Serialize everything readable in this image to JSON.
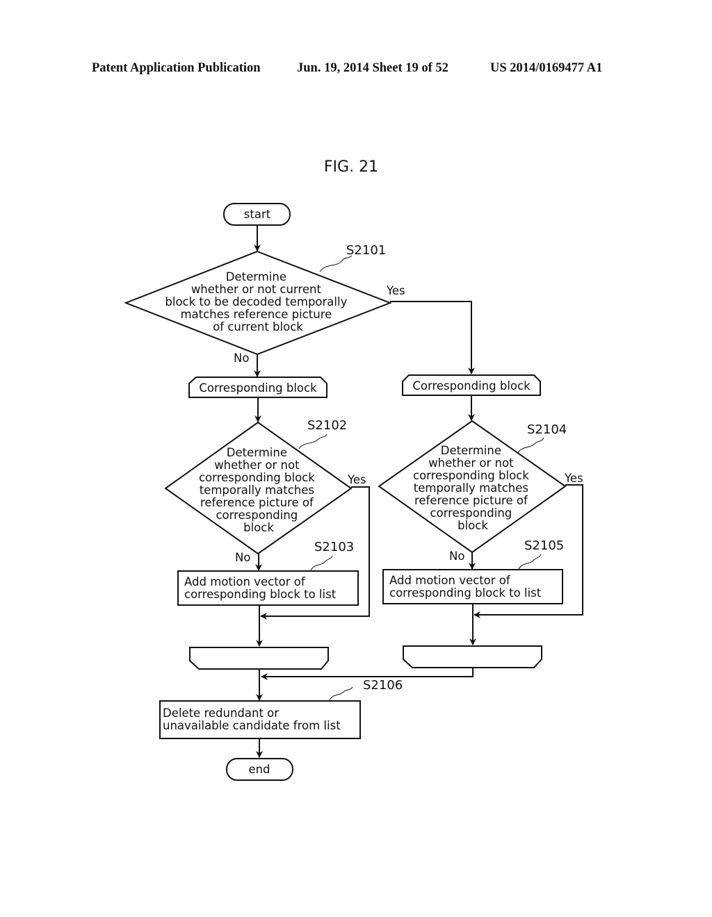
{
  "header": {
    "publication": "Patent Application Publication",
    "date_sheet": "Jun. 19, 2014  Sheet 19 of 52",
    "patent_number": "US 2014/0169477 A1"
  },
  "figure": {
    "title": "FIG. 21",
    "start_label": "start",
    "end_label": "end",
    "steps": {
      "s2101": {
        "ref": "S2101",
        "lines": [
          "Determine",
          "whether or not current",
          "block to be decoded temporally",
          "matches reference picture",
          "of current block"
        ]
      },
      "s2102": {
        "ref": "S2102",
        "lines": [
          "Determine",
          "whether or not",
          "corresponding block",
          "temporally matches",
          "reference picture of",
          "corresponding",
          "block"
        ]
      },
      "s2103": {
        "ref": "S2103",
        "lines": [
          "Add motion vector of",
          "corresponding block to list"
        ]
      },
      "s2104": {
        "ref": "S2104",
        "lines": [
          "Determine",
          "whether or not",
          "corresponding block",
          "temporally matches",
          "reference picture of",
          "corresponding",
          "block"
        ]
      },
      "s2105": {
        "ref": "S2105",
        "lines": [
          "Add motion vector of",
          "corresponding block to list"
        ]
      },
      "s2106": {
        "ref": "S2106",
        "lines": [
          "Delete redundant or",
          "unavailable candidate from list"
        ]
      }
    },
    "loop_left_label": "Corresponding block",
    "loop_right_label": "Corresponding block",
    "branch_labels": {
      "s2101_yes": "Yes",
      "s2101_no": "No",
      "s2102_yes": "Yes",
      "s2102_no": "No",
      "s2104_yes": "Yes",
      "s2104_no": "No"
    }
  }
}
